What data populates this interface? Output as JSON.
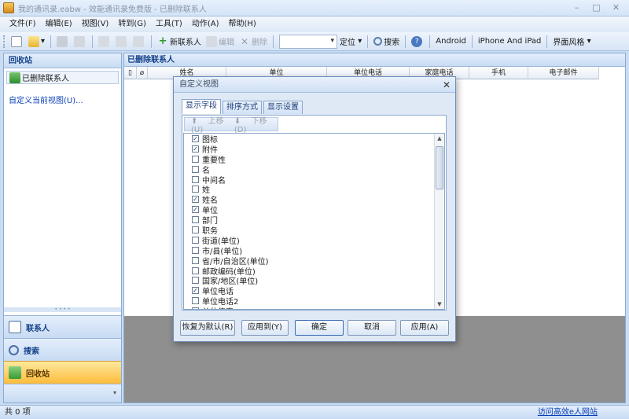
{
  "window": {
    "title": "我的通讯录.eabw - 效能通讯录免费版 - 已删除联系人"
  },
  "menu": [
    "文件(F)",
    "编辑(E)",
    "视图(V)",
    "转到(G)",
    "工具(T)",
    "动作(A)",
    "帮助(H)"
  ],
  "toolbar": {
    "new_contact": "新联系人",
    "edit": "编辑",
    "delete": "删除",
    "search_combo_value": "",
    "locate": "定位",
    "search": "搜索",
    "android": "Android",
    "iphone": "iPhone And iPad",
    "skin": "界面风格"
  },
  "nav": {
    "header": "回收站",
    "folder": "已删除联系人",
    "custom_view_link": "自定义当前视图(U)...",
    "buttons": [
      "联系人",
      "搜索",
      "回收站"
    ]
  },
  "content": {
    "header": "已删除联系人",
    "columns": [
      "",
      "",
      "姓名",
      "单位",
      "单位电话",
      "家庭电话",
      "手机",
      "电子邮件"
    ]
  },
  "status": {
    "count": "共 0 项",
    "link": "访问高效e人网站"
  },
  "dialog": {
    "title": "自定义视图",
    "tabs": [
      "显示字段",
      "排序方式",
      "显示设置"
    ],
    "move_up": "上移(U)",
    "move_down": "下移(D)",
    "fields": [
      {
        "label": "图标",
        "checked": true
      },
      {
        "label": "附件",
        "checked": true
      },
      {
        "label": "重要性",
        "checked": false
      },
      {
        "label": "名",
        "checked": false
      },
      {
        "label": "中间名",
        "checked": false
      },
      {
        "label": "姓",
        "checked": false
      },
      {
        "label": "姓名",
        "checked": true
      },
      {
        "label": "单位",
        "checked": true
      },
      {
        "label": "部门",
        "checked": false
      },
      {
        "label": "职务",
        "checked": false
      },
      {
        "label": "街道(单位)",
        "checked": false
      },
      {
        "label": "市/县(单位)",
        "checked": false
      },
      {
        "label": "省/市/自治区(单位)",
        "checked": false
      },
      {
        "label": "邮政编码(单位)",
        "checked": false
      },
      {
        "label": "国家/地区(单位)",
        "checked": false
      },
      {
        "label": "单位电话",
        "checked": true
      },
      {
        "label": "单位电话2",
        "checked": false
      },
      {
        "label": "单位传真",
        "checked": false
      }
    ],
    "buttons": [
      "恢复为默认(R)",
      "应用到(Y)",
      "确定",
      "取消",
      "应用(A)"
    ]
  }
}
